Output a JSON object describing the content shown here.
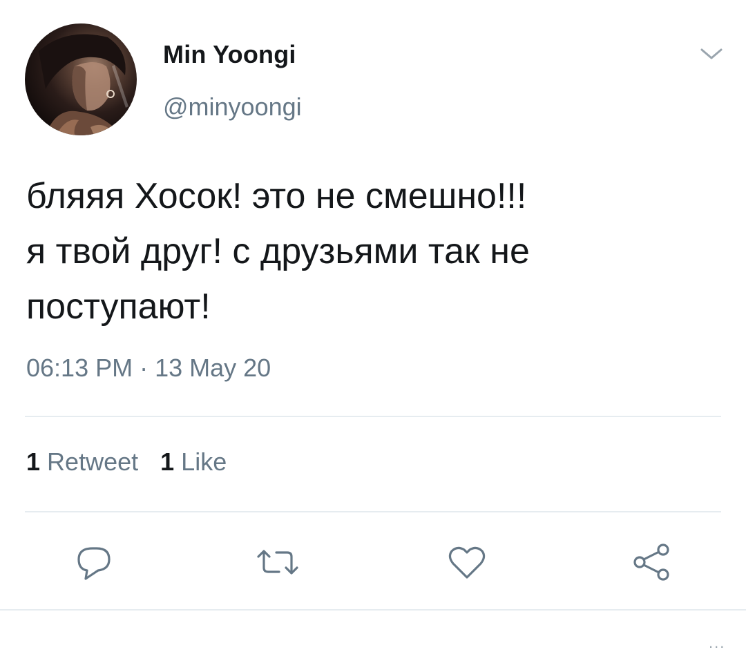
{
  "user": {
    "display_name": "Min Yoongi",
    "handle": "@minyoongi",
    "avatar_icon": "profile-photo"
  },
  "tweet": {
    "lines": [
      "бляяя Хосок! это не смешно!!!",
      "я твой друг! с друзьями так не",
      "поступают!"
    ],
    "timestamp": "06:13 PM · 13 May 20"
  },
  "stats": {
    "retweets_count": "1",
    "retweets_label": "Retweet",
    "likes_count": "1",
    "likes_label": "Like"
  },
  "actions": {
    "reply_icon": "speech-bubble-icon",
    "retweet_icon": "retweet-arrows-icon",
    "like_icon": "heart-icon",
    "share_icon": "share-nodes-icon",
    "more_label": "..."
  },
  "colors": {
    "text": "#14171a",
    "secondary": "#657786",
    "divider": "#e6ecf0"
  }
}
